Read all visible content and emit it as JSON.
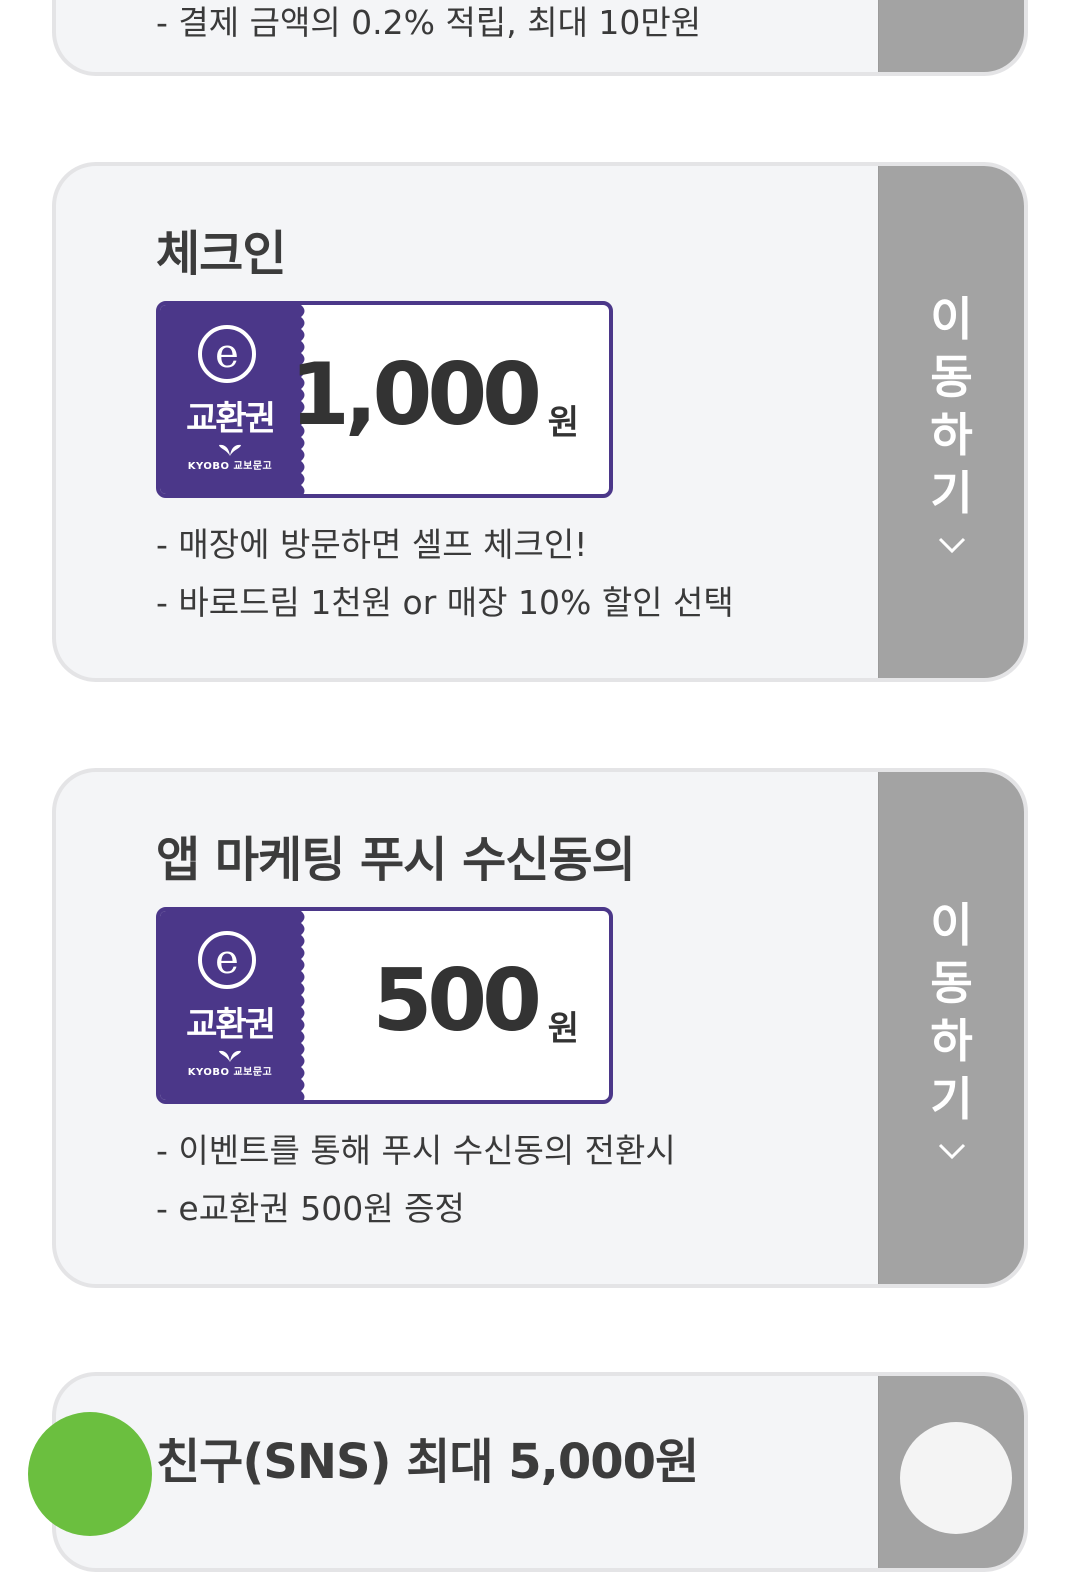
{
  "cards": [
    {
      "desc": [
        "- 결제 금액의 0.2% 적립, 최대 10만원"
      ]
    },
    {
      "title": "체크인",
      "ticket": {
        "name": "교환권",
        "brand": "KYOBO 교보문고",
        "amount": "1,000",
        "unit": "원"
      },
      "desc": [
        "- 매장에 방문하면 셀프 체크인!",
        "- 바로드림 1천원 or 매장 10% 할인 선택"
      ],
      "action": "이동하기"
    },
    {
      "title": "앱 마케팅 푸시 수신동의",
      "ticket": {
        "name": "교환권",
        "brand": "KYOBO 교보문고",
        "amount": "500",
        "unit": "원"
      },
      "desc": [
        "- 이벤트를 통해 푸시 수신동의 전환시",
        "- e교환권 500원 증정"
      ],
      "action": "이동하기"
    },
    {
      "title_partial": "친구(SNS) 최대 5,000원"
    }
  ],
  "colors": {
    "ticket_purple": "#4b3789",
    "side_gray": "#a3a3a3",
    "card_bg": "#f4f5f7",
    "fab_green": "#6bbf3f"
  },
  "icons": [
    "e-logo-icon",
    "leaf-icon",
    "chevron-down-icon"
  ]
}
